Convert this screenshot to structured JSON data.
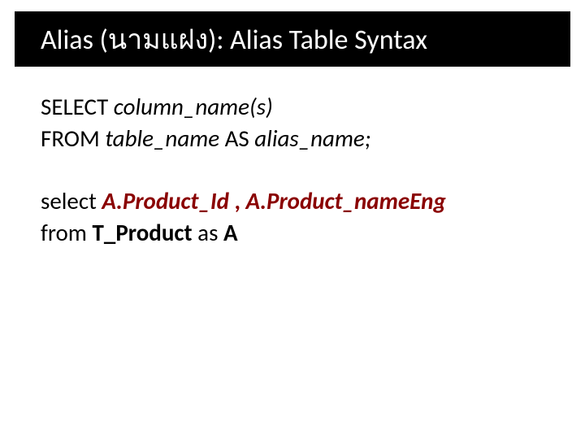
{
  "title": "Alias (นามแฝง): Alias Table Syntax",
  "syntax": {
    "line1_a": "SELECT ",
    "line1_b": "column_name(s)",
    "line2_a": "FROM ",
    "line2_b": "table_name",
    "line2_c": " AS ",
    "line2_d": "alias_name;"
  },
  "example": {
    "line1_a": "select ",
    "line1_b": "A.Product_Id",
    "line1_c": " , ",
    "line1_d": "A.Product_nameEng",
    "line2_a": "from ",
    "line2_b": "T_Product",
    "line2_c": " as ",
    "line2_d": "A"
  }
}
